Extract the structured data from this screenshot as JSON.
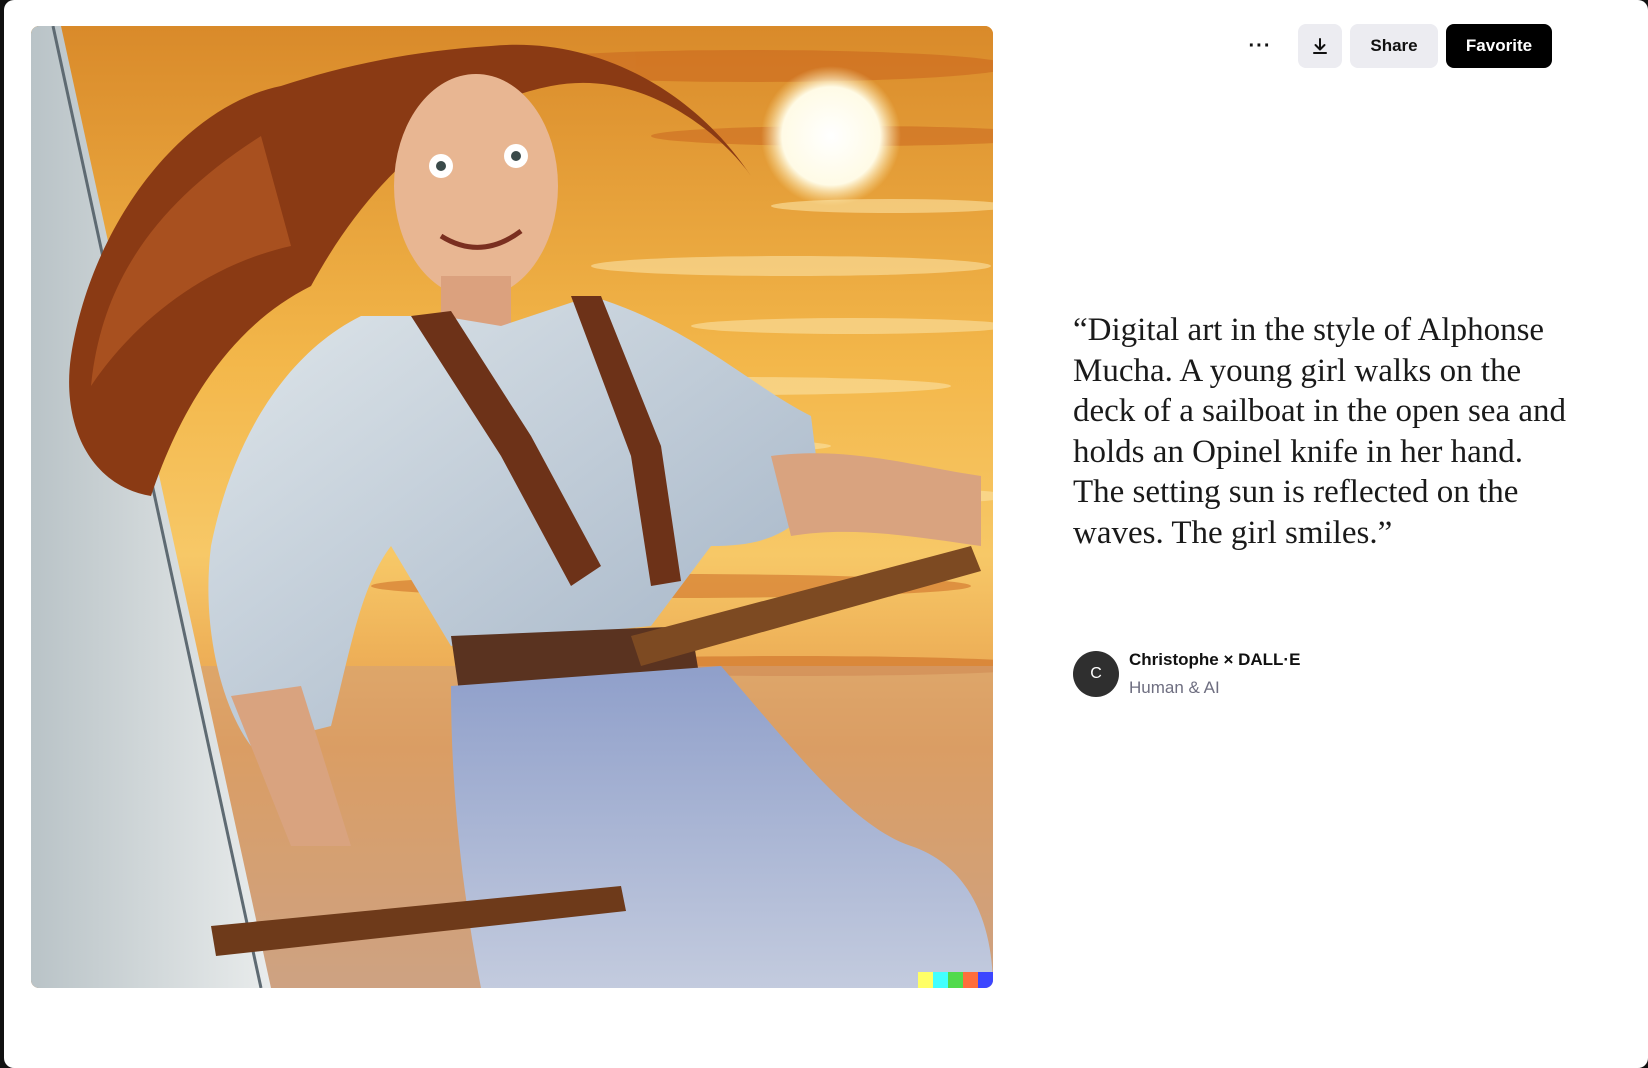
{
  "artwork": {
    "alt": "Digital art in the style of Alphonse Mucha. A young girl walks on the deck of a sailboat in the open sea and holds an Opinel knife in her hand. The setting sun is reflected on the waves. The girl smiles.",
    "watermark_colors": [
      "#ffff66",
      "#42ffff",
      "#51da4c",
      "#ff6e3c",
      "#3c46ff"
    ]
  },
  "toolbar": {
    "more_label": "···",
    "download_icon": "download-icon",
    "share_label": "Share",
    "favorite_label": "Favorite"
  },
  "prompt": {
    "text": "“Digital art in the style of Alphonse Mucha. A young girl walks on the deck of a sailboat in the open sea and holds an Opinel knife in her hand. The setting sun is reflected on the waves. The girl smiles.”"
  },
  "credit": {
    "avatar_initial": "C",
    "name": "Christophe × DALL·E",
    "subtitle": "Human & AI"
  }
}
